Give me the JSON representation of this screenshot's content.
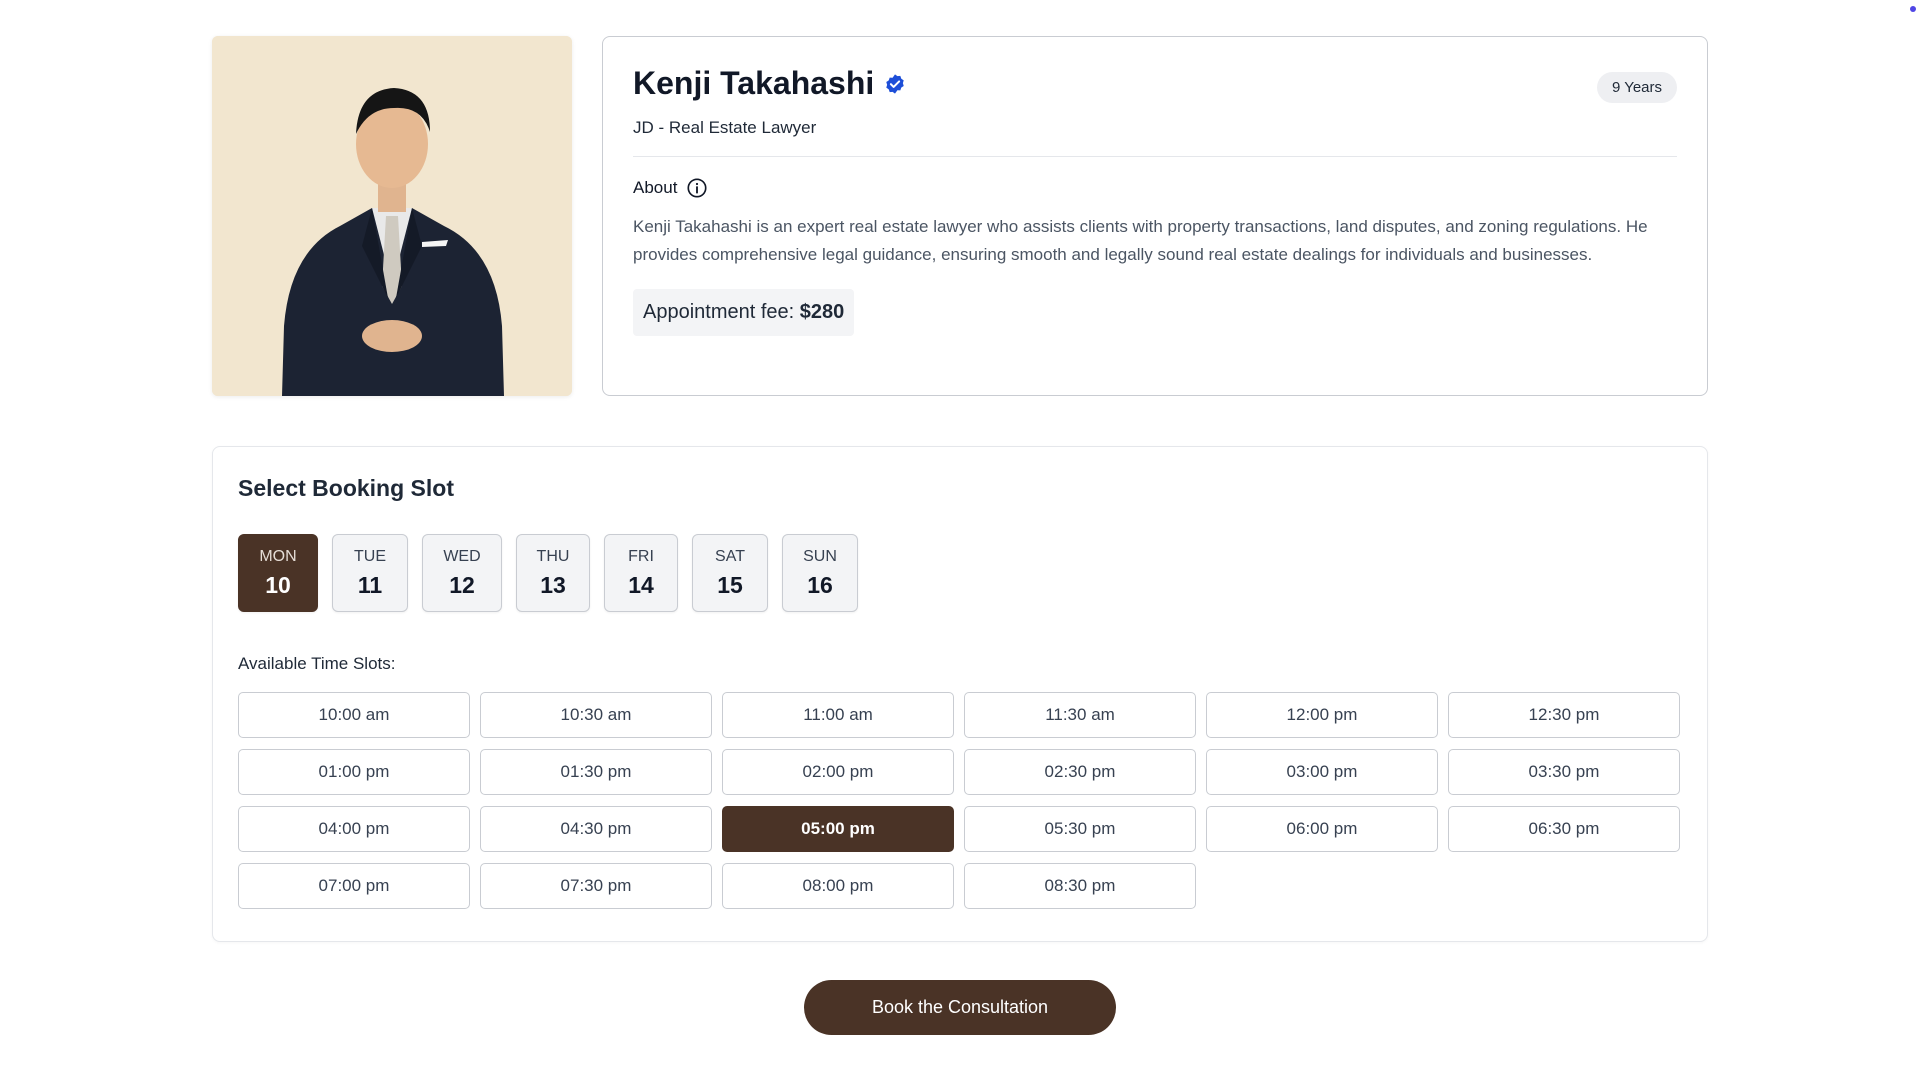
{
  "profile": {
    "name": "Kenji Takahashi",
    "experience_badge": "9 Years",
    "title": "JD - Real Estate Lawyer",
    "about_label": "About",
    "about_text": "Kenji Takahashi is an expert real estate lawyer who assists clients with property transactions, land disputes, and zoning regulations. He provides comprehensive legal guidance, ensuring smooth and legally sound real estate dealings for individuals and businesses.",
    "fee_label": "Appointment fee:",
    "fee_value": "$280",
    "verified_icon": "verified-check-icon",
    "info_icon": "info-icon"
  },
  "booking": {
    "title": "Select Booking Slot",
    "days": [
      {
        "day": "MON",
        "date": "10",
        "selected": true
      },
      {
        "day": "TUE",
        "date": "11",
        "selected": false
      },
      {
        "day": "WED",
        "date": "12",
        "selected": false
      },
      {
        "day": "THU",
        "date": "13",
        "selected": false
      },
      {
        "day": "FRI",
        "date": "14",
        "selected": false
      },
      {
        "day": "SAT",
        "date": "15",
        "selected": false
      },
      {
        "day": "SUN",
        "date": "16",
        "selected": false
      }
    ],
    "slots_label": "Available Time Slots:",
    "slots": [
      "10:00 am",
      "10:30 am",
      "11:00 am",
      "11:30 am",
      "12:00 pm",
      "12:30 pm",
      "01:00 pm",
      "01:30 pm",
      "02:00 pm",
      "02:30 pm",
      "03:00 pm",
      "03:30 pm",
      "04:00 pm",
      "04:30 pm",
      "05:00 pm",
      "05:30 pm",
      "06:00 pm",
      "06:30 pm",
      "07:00 pm",
      "07:30 pm",
      "08:00 pm",
      "08:30 pm"
    ],
    "selected_slot": "05:00 pm"
  },
  "actions": {
    "book_label": "Book the Consultation"
  },
  "colors": {
    "accent": "#4a3326",
    "verified": "#1d4ed8",
    "photo_background": "#f2e6cf"
  }
}
